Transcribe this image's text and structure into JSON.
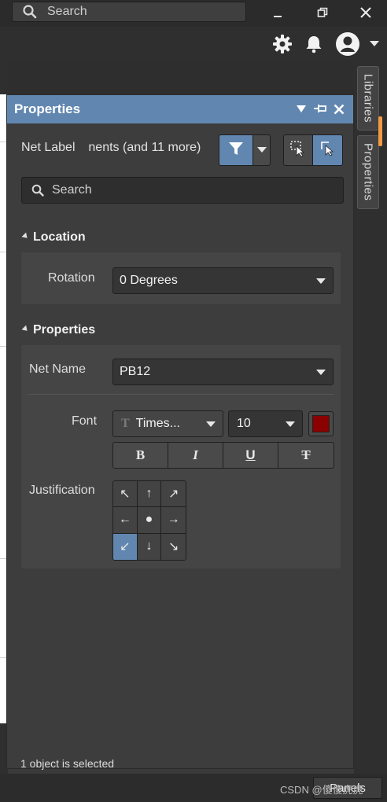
{
  "titlebar": {
    "search_placeholder": "Search",
    "minimize_icon": "minimize-icon",
    "restore_icon": "restore-icon",
    "close_icon": "close-icon"
  },
  "toolbar": {
    "icons": [
      "gear-icon",
      "bell-icon",
      "user-avatar-icon",
      "chevron-down-icon"
    ]
  },
  "side_tabs": [
    {
      "label": "Libraries"
    },
    {
      "label": "Properties"
    }
  ],
  "panel": {
    "title": "Properties",
    "object_type": "Net Label",
    "filter_text": "nents (and 11 more)",
    "search_placeholder": "Search",
    "sections": {
      "location": {
        "title": "Location",
        "rotation_label": "Rotation",
        "rotation_value": "0 Degrees"
      },
      "properties": {
        "title": "Properties",
        "net_name_label": "Net Name",
        "net_name_value": "PB12",
        "font_label": "Font",
        "font_family_value": "Times...",
        "font_size_value": "10",
        "font_color": "#8b0000",
        "style_buttons": [
          "B",
          "I",
          "U",
          "T"
        ],
        "justification_label": "Justification",
        "justification_cells": [
          "↖",
          "↑",
          "↗",
          "←",
          "●",
          "→",
          "↙",
          "↓",
          "↘"
        ],
        "justification_selected": "↙"
      }
    },
    "status": "1 object is selected"
  },
  "bottom": {
    "panels_button": "Panels",
    "watermark": "CSDN @傻傻虎虎"
  },
  "colors": {
    "accent_blue": "#6187b0",
    "scroll_accent": "#f39a43"
  }
}
